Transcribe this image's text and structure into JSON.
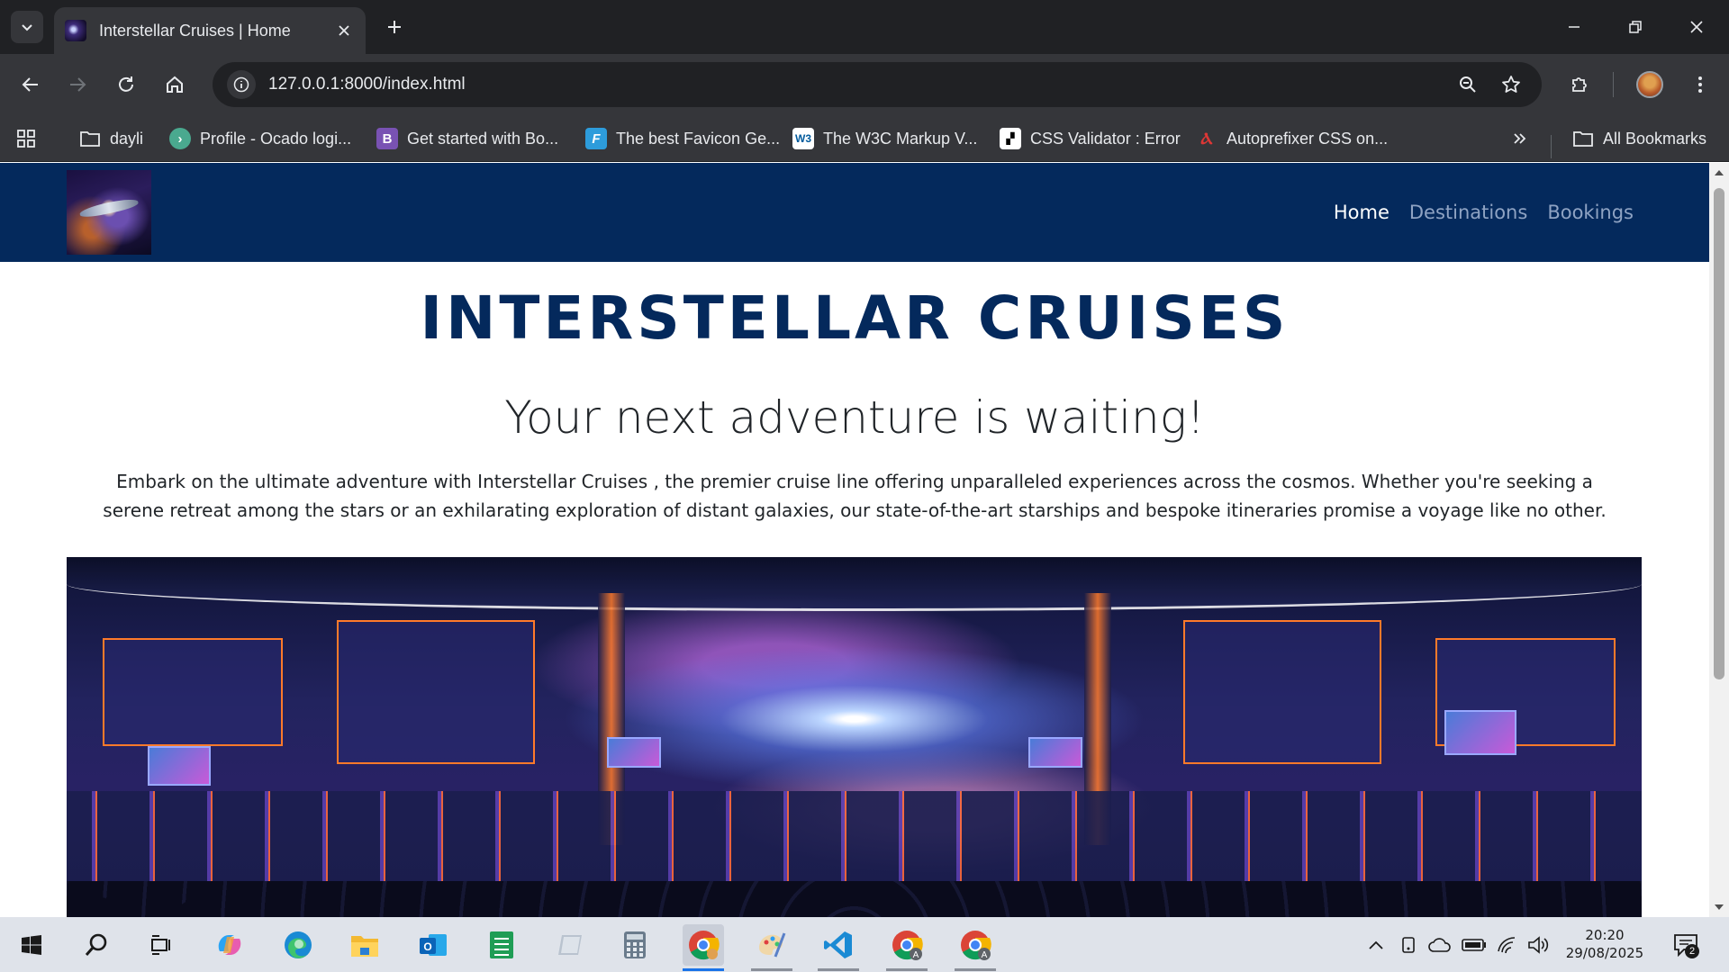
{
  "browser": {
    "tab": {
      "title": "Interstellar Cruises | Home",
      "favicon": "galaxy-favicon"
    },
    "url": "127.0.0.1:8000/index.html",
    "bookmarks": [
      {
        "label": "dayli",
        "icon": "folder-icon"
      },
      {
        "label": "Profile - Ocado logi...",
        "icon": "ocado-icon"
      },
      {
        "label": "Get started with Bo...",
        "icon": "bootstrap-icon"
      },
      {
        "label": "The best Favicon Ge...",
        "icon": "favicon-generator-icon"
      },
      {
        "label": "The W3C Markup V...",
        "icon": "w3c-icon"
      },
      {
        "label": "CSS Validator : Error",
        "icon": "css-validator-icon"
      },
      {
        "label": "Autoprefixer CSS on...",
        "icon": "autoprefixer-icon"
      }
    ],
    "all_bookmarks": "All Bookmarks"
  },
  "site": {
    "nav": {
      "home": "Home",
      "destinations": "Destinations",
      "bookings": "Bookings"
    },
    "brand": "INTERSTELLAR CRUISES",
    "tagline": "Your next adventure is waiting!",
    "intro": "Embark on the ultimate adventure with Interstellar Cruises , the premier cruise line offering unparalleled experiences across the cosmos. Whether you're seeking a serene retreat among the stars or an exhilarating exploration of distant galaxies, our state-of-the-art starships and bespoke itineraries promise a voyage like no other."
  },
  "taskbar": {
    "time": "20:20",
    "date": "29/08/2025",
    "notifications": "2",
    "apps": [
      "start-icon",
      "search-icon",
      "task-view-icon",
      "copilot-icon",
      "edge-icon",
      "file-explorer-icon",
      "outlook-icon",
      "sheets-icon",
      "app-icon",
      "calculator-icon",
      "chrome-icon",
      "paint-icon",
      "vscode-icon",
      "chrome-profile-a-icon",
      "chrome-profile-a2-icon"
    ]
  },
  "colors": {
    "nav_bg": "#04295c",
    "brand": "#04295c",
    "chrome_dark": "#202124",
    "chrome_mid": "#35363a"
  }
}
